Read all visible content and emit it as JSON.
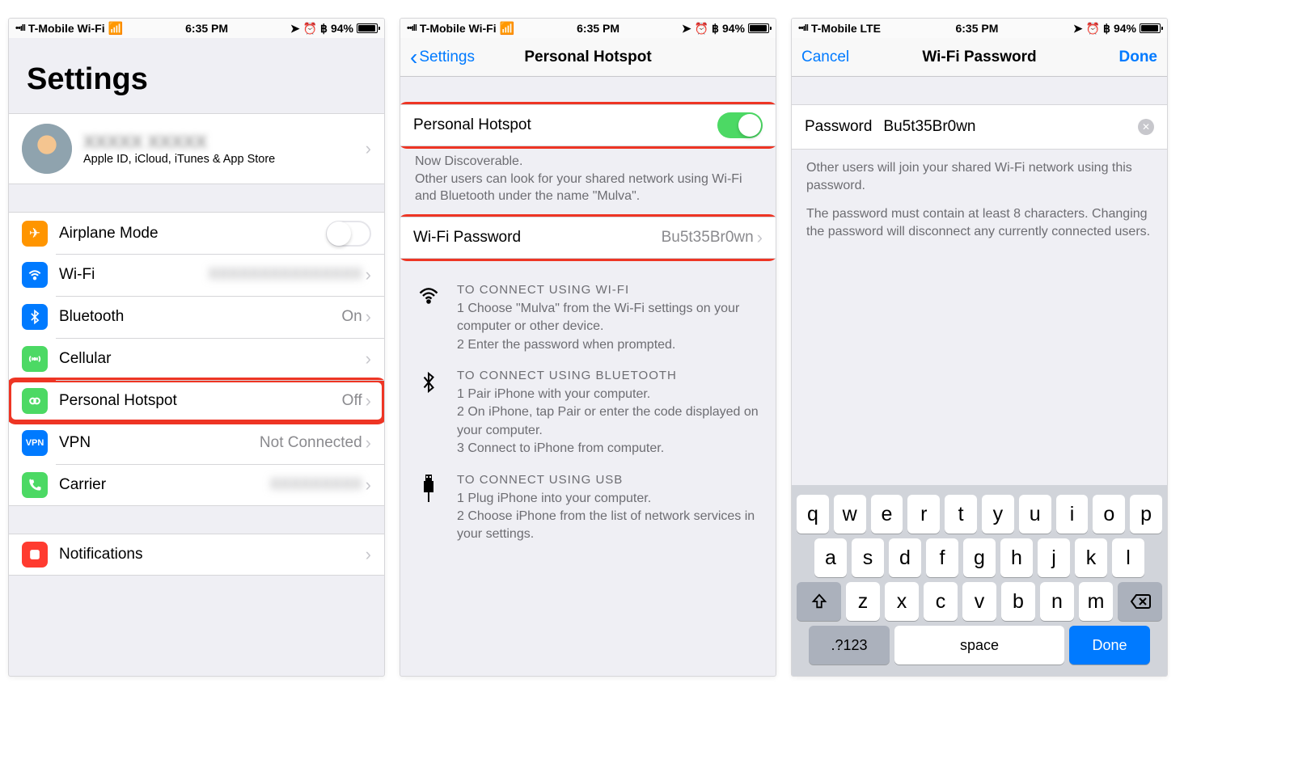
{
  "screen1": {
    "status": {
      "carrier": "T-Mobile Wi-Fi",
      "time": "6:35 PM",
      "battery": "94%"
    },
    "title": "Settings",
    "profile": {
      "name": "XXXXX XXXXX",
      "sub": "Apple ID, iCloud, iTunes & App Store"
    },
    "rows": {
      "airplane": "Airplane Mode",
      "wifi": "Wi-Fi",
      "bluetooth": "Bluetooth",
      "bluetooth_val": "On",
      "cellular": "Cellular",
      "hotspot": "Personal Hotspot",
      "hotspot_val": "Off",
      "vpn": "VPN",
      "vpn_val": "Not Connected",
      "carrier": "Carrier",
      "notifications": "Notifications"
    }
  },
  "screen2": {
    "status": {
      "carrier": "T-Mobile Wi-Fi",
      "time": "6:35 PM",
      "battery": "94%"
    },
    "nav": {
      "back": "Settings",
      "title": "Personal Hotspot"
    },
    "hotspot_label": "Personal Hotspot",
    "discoverable": "Now Discoverable.",
    "discoverable_text": "Other users can look for your shared network using Wi-Fi and Bluetooth under the name \"Mulva\".",
    "wifi_pw_label": "Wi-Fi Password",
    "wifi_pw_value": "Bu5t35Br0wn",
    "sections": {
      "wifi_hdr": "TO CONNECT USING WI-FI",
      "wifi_1": "1 Choose \"Mulva\" from the Wi-Fi settings on your computer or other device.",
      "wifi_2": "2 Enter the password when prompted.",
      "bt_hdr": "TO CONNECT USING BLUETOOTH",
      "bt_1": "1 Pair iPhone with your computer.",
      "bt_2": "2 On iPhone, tap Pair or enter the code displayed on your computer.",
      "bt_3": "3 Connect to iPhone from computer.",
      "usb_hdr": "TO CONNECT USING USB",
      "usb_1": "1 Plug iPhone into your computer.",
      "usb_2": "2 Choose iPhone from the list of network services in your settings."
    }
  },
  "screen3": {
    "status": {
      "carrier": "T-Mobile  LTE",
      "time": "6:35 PM",
      "battery": "94%"
    },
    "nav": {
      "cancel": "Cancel",
      "title": "Wi-Fi Password",
      "done": "Done"
    },
    "pw_label": "Password",
    "pw_value": "Bu5t35Br0wn",
    "help1": "Other users will join your shared Wi-Fi network using this password.",
    "help2": "The password must contain at least 8 characters. Changing the password will disconnect any currently connected users.",
    "keyboard": {
      "row1": [
        "q",
        "w",
        "e",
        "r",
        "t",
        "y",
        "u",
        "i",
        "o",
        "p"
      ],
      "row2": [
        "a",
        "s",
        "d",
        "f",
        "g",
        "h",
        "j",
        "k",
        "l"
      ],
      "row3": [
        "z",
        "x",
        "c",
        "v",
        "b",
        "n",
        "m"
      ],
      "numbers": ".?123",
      "space": "space",
      "done": "Done"
    }
  }
}
